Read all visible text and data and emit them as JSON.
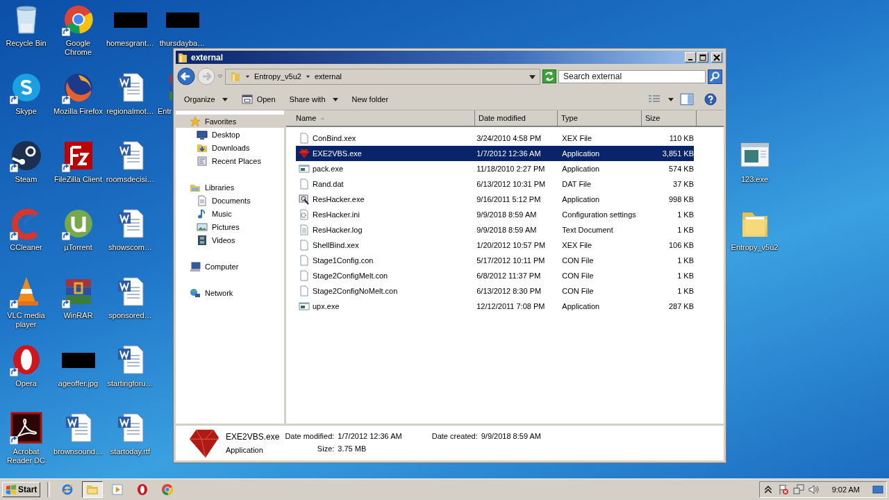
{
  "desktop": {
    "icons": [
      {
        "label": "Recycle Bin",
        "kind": "recycle",
        "shortcut": false
      },
      {
        "label": "Skype",
        "kind": "skype",
        "shortcut": true
      },
      {
        "label": "Steam",
        "kind": "steam",
        "shortcut": true
      },
      {
        "label": "CCleaner",
        "kind": "ccleaner",
        "shortcut": true
      },
      {
        "label": "VLC media player",
        "kind": "vlc",
        "shortcut": true
      },
      {
        "label": "Opera",
        "kind": "opera",
        "shortcut": true
      },
      {
        "label": "Acrobat Reader DC",
        "kind": "acrobat",
        "shortcut": true
      },
      {
        "label": "Google Chrome",
        "kind": "chrome",
        "shortcut": true
      },
      {
        "label": "Mozilla Firefox",
        "kind": "firefox",
        "shortcut": true
      },
      {
        "label": "FileZilla Client",
        "kind": "filezilla",
        "shortcut": true
      },
      {
        "label": "µTorrent",
        "kind": "utorrent",
        "shortcut": true
      },
      {
        "label": "WinRAR",
        "kind": "winrar",
        "shortcut": true
      },
      {
        "label": "ageoffer.jpg",
        "kind": "redacted",
        "shortcut": false
      },
      {
        "label": "brownsound…",
        "kind": "word",
        "shortcut": false
      },
      {
        "label": "homesgrant…",
        "kind": "redacted",
        "shortcut": false
      },
      {
        "label": "regionalmot…",
        "kind": "word",
        "shortcut": false
      },
      {
        "label": "roomsdecisi…",
        "kind": "word",
        "shortcut": false
      },
      {
        "label": "showscom…",
        "kind": "word",
        "shortcut": false
      },
      {
        "label": "sponsored…",
        "kind": "word",
        "shortcut": false
      },
      {
        "label": "startingforu…",
        "kind": "word",
        "shortcut": false
      },
      {
        "label": "startoday.rtf",
        "kind": "word",
        "shortcut": false
      },
      {
        "label": "thursdayba…",
        "kind": "redacted",
        "shortcut": false
      },
      {
        "label": "Entr",
        "kind": "winrar",
        "shortcut": false
      }
    ],
    "right_icons": [
      {
        "label": "123.exe",
        "kind": "exe",
        "shortcut": false
      },
      {
        "label": "Entropy_v5u2",
        "kind": "folder",
        "shortcut": false
      }
    ]
  },
  "window": {
    "title": "external",
    "breadcrumb": [
      "Entropy_v5u2",
      "external"
    ],
    "search": {
      "placeholder": "Search external"
    },
    "toolbar": [
      {
        "label": "Organize",
        "dropdown": true,
        "kind": "plain"
      },
      {
        "label": "Open",
        "dropdown": false,
        "kind": "open"
      },
      {
        "label": "Share with",
        "dropdown": true,
        "kind": "plain"
      },
      {
        "label": "New folder",
        "dropdown": false,
        "kind": "plain"
      }
    ],
    "sidebar": [
      {
        "label": "Favorites",
        "kind": "star",
        "selected": true,
        "children": [
          {
            "label": "Desktop",
            "kind": "desktop",
            "selected": false
          },
          {
            "label": "Downloads",
            "kind": "downloads",
            "selected": false
          },
          {
            "label": "Recent Places",
            "kind": "recent",
            "selected": false
          }
        ]
      },
      {
        "label": "Libraries",
        "kind": "libraries",
        "selected": false,
        "children": [
          {
            "label": "Documents",
            "kind": "documents",
            "selected": false
          },
          {
            "label": "Music",
            "kind": "music",
            "selected": false
          },
          {
            "label": "Pictures",
            "kind": "pictures",
            "selected": false
          },
          {
            "label": "Videos",
            "kind": "videos",
            "selected": false
          }
        ]
      },
      {
        "label": "Computer",
        "kind": "computer",
        "selected": false
      },
      {
        "label": "Network",
        "kind": "network",
        "selected": false
      }
    ],
    "columns": [
      {
        "label": "Name",
        "sorted": true
      },
      {
        "label": "Date modified",
        "sorted": false
      },
      {
        "label": "Type",
        "sorted": false
      },
      {
        "label": "Size",
        "sorted": false
      }
    ],
    "rows": [
      {
        "name": "ConBind.xex",
        "date": "3/24/2010 4:58 PM",
        "type": "XEX File",
        "size": "110 KB",
        "kind": "blank",
        "selected": false
      },
      {
        "name": "EXE2VBS.exe",
        "date": "1/7/2012 12:36 AM",
        "type": "Application",
        "size": "3,851 KB",
        "kind": "ruby",
        "selected": true
      },
      {
        "name": "pack.exe",
        "date": "11/18/2010 2:27 PM",
        "type": "Application",
        "size": "574 KB",
        "kind": "app",
        "selected": false
      },
      {
        "name": "Rand.dat",
        "date": "6/13/2012 10:31 PM",
        "type": "DAT File",
        "size": "37 KB",
        "kind": "blank",
        "selected": false
      },
      {
        "name": "ResHacker.exe",
        "date": "9/16/2011 5:12 PM",
        "type": "Application",
        "size": "998 KB",
        "kind": "reshacker",
        "selected": false
      },
      {
        "name": "ResHacker.ini",
        "date": "9/9/2018 8:59 AM",
        "type": "Configuration settings",
        "size": "1 KB",
        "kind": "ini",
        "selected": false
      },
      {
        "name": "ResHacker.log",
        "date": "9/9/2018 8:59 AM",
        "type": "Text Document",
        "size": "1 KB",
        "kind": "text",
        "selected": false
      },
      {
        "name": "ShellBind.xex",
        "date": "1/20/2012 10:57 PM",
        "type": "XEX File",
        "size": "106 KB",
        "kind": "blank",
        "selected": false
      },
      {
        "name": "Stage1Config.con",
        "date": "5/17/2012 10:11 PM",
        "type": "CON File",
        "size": "1 KB",
        "kind": "blank",
        "selected": false
      },
      {
        "name": "Stage2ConfigMelt.con",
        "date": "6/8/2012 11:37 PM",
        "type": "CON File",
        "size": "1 KB",
        "kind": "blank",
        "selected": false
      },
      {
        "name": "Stage2ConfigNoMelt.con",
        "date": "6/13/2012 8:30 PM",
        "type": "CON File",
        "size": "1 KB",
        "kind": "blank",
        "selected": false
      },
      {
        "name": "upx.exe",
        "date": "12/12/2011 7:08 PM",
        "type": "Application",
        "size": "287 KB",
        "kind": "app",
        "selected": false
      }
    ],
    "details": {
      "name": "EXE2VBS.exe",
      "type": "Application",
      "fields": [
        {
          "label": "Date modified:",
          "value": "1/7/2012 12:36 AM"
        },
        {
          "label": "Size:",
          "value": "3.75 MB"
        },
        {
          "label": "Date created:",
          "value": "9/9/2018 8:59 AM"
        }
      ]
    }
  },
  "taskbar": {
    "start": "Start",
    "apps": [
      {
        "kind": "ie",
        "active": false
      },
      {
        "kind": "explorer",
        "active": true
      },
      {
        "kind": "media",
        "active": false
      },
      {
        "kind": "opera",
        "active": false
      },
      {
        "kind": "chrome",
        "active": false
      }
    ],
    "time": "9:02 AM"
  }
}
